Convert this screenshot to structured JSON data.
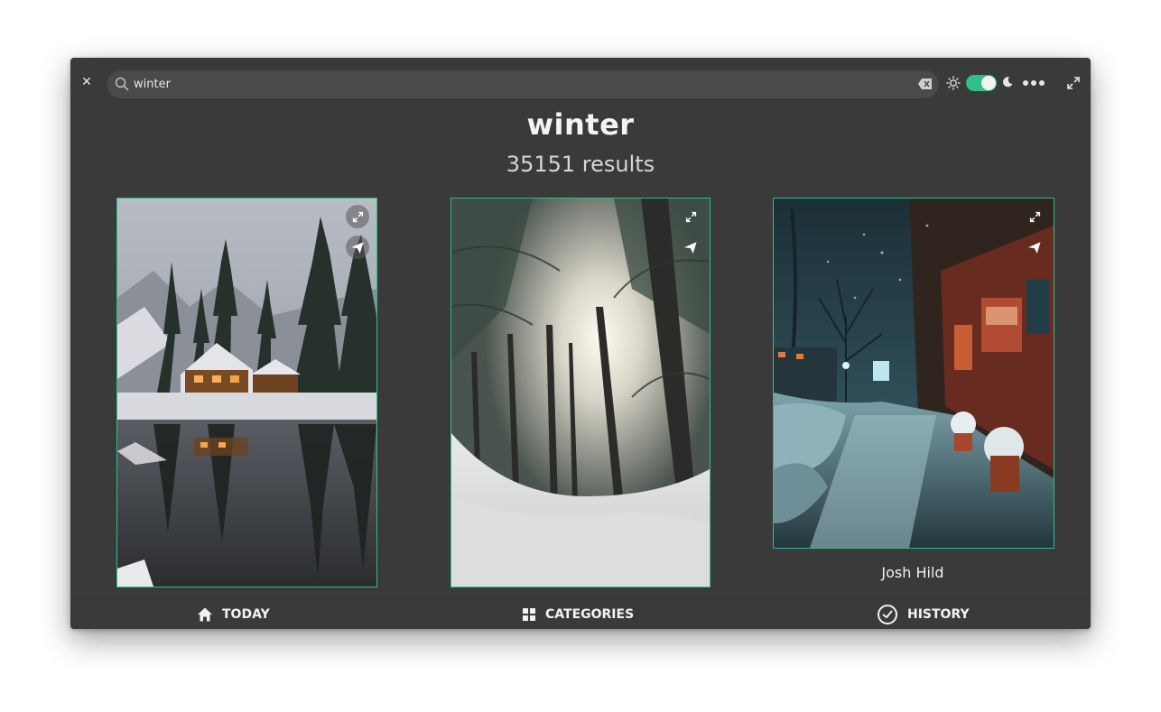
{
  "window": {
    "close_icon": "close-icon",
    "maximize_icon": "expand-icon"
  },
  "search": {
    "value": "winter",
    "icon": "search-icon",
    "clear_icon": "backspace-icon"
  },
  "theme": {
    "light_icon": "sun-icon",
    "dark_icon": "moon-icon",
    "dark_mode_enabled": true,
    "accent": "#2fbf87"
  },
  "menu_icon": "more-dots-icon",
  "results": {
    "query": "winter",
    "count_text": "35151 results"
  },
  "photos": [
    {
      "subject": "snowy lakeside lodge",
      "controls": [
        "expand-icon",
        "send-icon"
      ]
    },
    {
      "subject": "snowy forest sunlight",
      "controls": [
        "expand-icon",
        "send-icon"
      ]
    },
    {
      "subject": "snowy city street at night",
      "author": "Josh Hild",
      "controls": [
        "expand-icon",
        "send-icon"
      ]
    }
  ],
  "nav": {
    "today": "TODAY",
    "categories": "CATEGORIES",
    "history": "HISTORY"
  }
}
